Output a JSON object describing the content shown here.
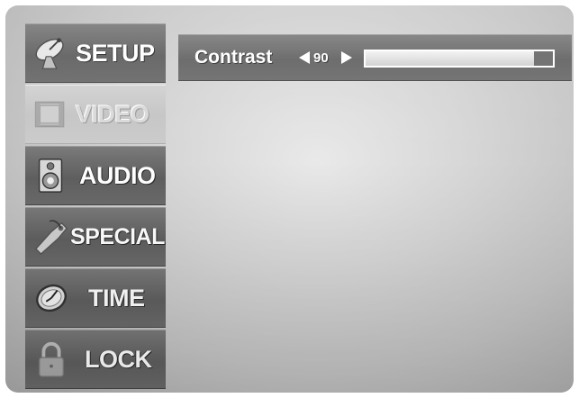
{
  "menu": {
    "items": [
      {
        "key": "setup",
        "label": "SETUP",
        "icon": "satellite-dish-icon",
        "active": false
      },
      {
        "key": "video",
        "label": "VIDEO",
        "icon": "film-frame-icon",
        "active": true
      },
      {
        "key": "audio",
        "label": "AUDIO",
        "icon": "speaker-icon",
        "active": false
      },
      {
        "key": "special",
        "label": "SPECIAL",
        "icon": "tag-icon",
        "active": false
      },
      {
        "key": "time",
        "label": "TIME",
        "icon": "clock-icon",
        "active": false
      },
      {
        "key": "lock",
        "label": "LOCK",
        "icon": "padlock-icon",
        "active": false
      }
    ]
  },
  "setting": {
    "name": "Contrast",
    "value": "90",
    "level_percent": 90
  },
  "colors": {
    "panel": "#666666",
    "active_panel": "#c9c9c9",
    "text": "#ffffff"
  }
}
